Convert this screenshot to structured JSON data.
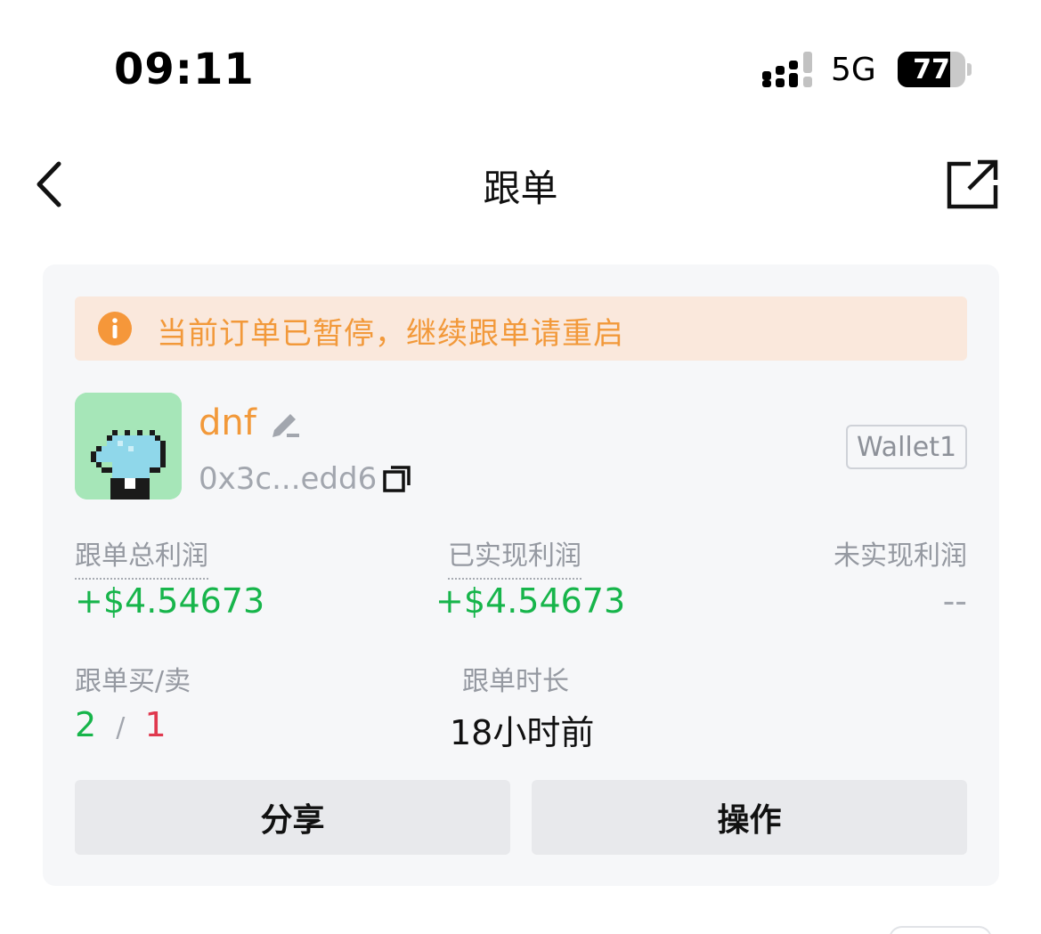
{
  "status_bar": {
    "time": "09:11",
    "network": "5G",
    "battery_level": 77,
    "battery_text": "77"
  },
  "nav": {
    "title": "跟单"
  },
  "notice": {
    "text": "当前订单已暂停，继续跟单请重启",
    "color": "#f2993a"
  },
  "trader": {
    "name": "dnf",
    "address": "0x3c...edd6",
    "wallet": "Wallet1"
  },
  "stats": {
    "total_profit_label": "跟单总利润",
    "total_profit_value": "+$4.54673",
    "realized_profit_label": "已实现利润",
    "realized_profit_value": "+$4.54673",
    "unrealized_profit_label": "未实现利润",
    "unrealized_profit_value": "--",
    "buy_sell_label": "跟单买/卖",
    "buy_count": "2",
    "separator": "/",
    "sell_count": "1",
    "duration_label": "跟单时长",
    "duration_value": "18小时前"
  },
  "actions": {
    "share_label": "分享",
    "operate_label": "操作"
  },
  "colors": {
    "accent_orange": "#f2993a",
    "profit_green": "#17b54b",
    "sell_red": "#e0394f"
  },
  "icons": [
    "signal-icon",
    "back-icon",
    "share-external-icon",
    "info-icon",
    "edit-icon",
    "copy-icon"
  ]
}
